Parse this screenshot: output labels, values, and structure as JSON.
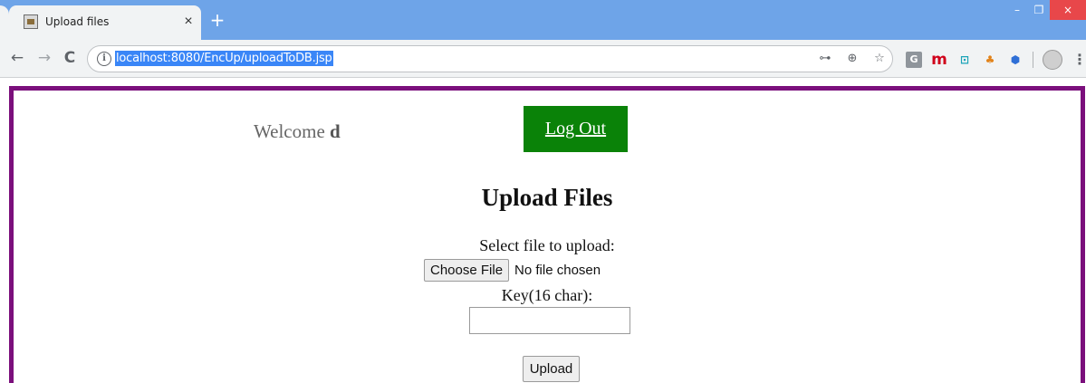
{
  "browser": {
    "tab": {
      "title": "Upload files",
      "close_glyph": "×",
      "favicon": "page-icon"
    },
    "new_tab_glyph": "+",
    "window": {
      "minimize_glyph": "–",
      "restore_glyph": "❐",
      "close_glyph": "×"
    },
    "nav": {
      "back_glyph": "←",
      "forward_glyph": "→",
      "reload_glyph": "C"
    },
    "address": {
      "url": "localhost:8080/EncUp/uploadToDB.jsp",
      "info_glyph": "i"
    },
    "omnibox_icons": {
      "key": "⊶",
      "zoom": "⊕",
      "star": "☆"
    },
    "extensions": [
      {
        "name": "g-extension-icon",
        "glyph": "G"
      },
      {
        "name": "m-extension-icon",
        "glyph": "m"
      },
      {
        "name": "box-extension-icon",
        "glyph": "⊡"
      },
      {
        "name": "maple-extension-icon",
        "glyph": "♣"
      },
      {
        "name": "shield-extension-icon",
        "glyph": "⬢"
      }
    ],
    "menu_glyph": "⋮"
  },
  "page": {
    "welcome_prefix": "Welcome ",
    "username": "d",
    "logout_label": "Log Out",
    "title": "Upload Files",
    "select_label": "Select file to upload:",
    "choose_file_label": "Choose File",
    "file_status": "No file chosen",
    "key_label": "Key(16 char):",
    "key_value": "",
    "upload_label": "Upload"
  },
  "colors": {
    "frame": "#7b0f7c",
    "logout_bg": "#0a8208",
    "tabbar": "#6ea4e8",
    "url_highlight": "#3a86f7"
  }
}
